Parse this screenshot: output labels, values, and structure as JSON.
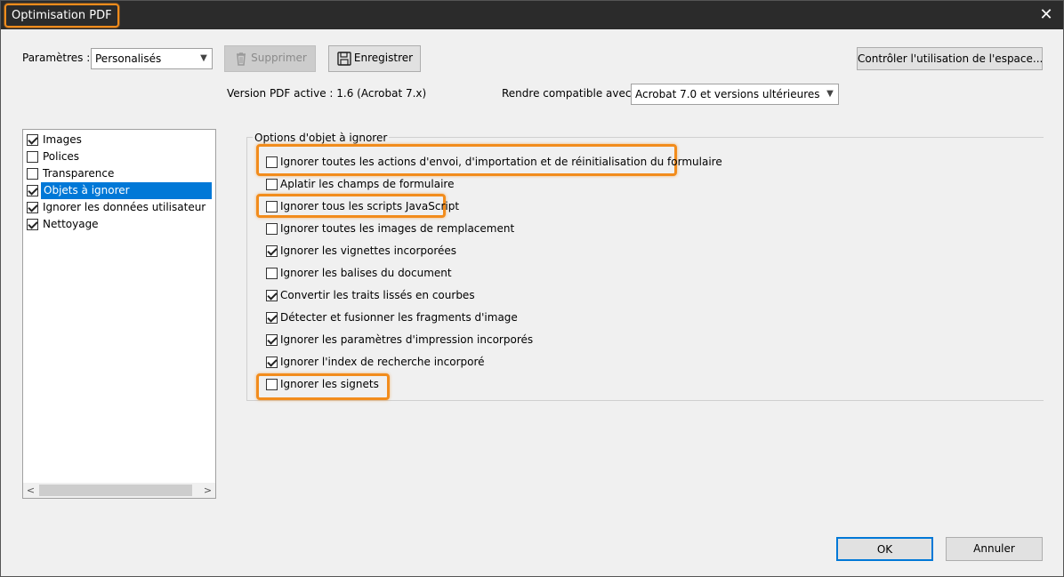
{
  "window": {
    "title": "Optimisation PDF",
    "close_glyph": "✕"
  },
  "toolbar": {
    "settings_label": "Paramètres :",
    "settings_value": "Personalisés",
    "delete_label": "Supprimer",
    "save_label": "Enregistrer",
    "check_space_label": "Contrôler l'utilisation de l'espace..."
  },
  "info": {
    "version_text": "Version PDF active : 1.6 (Acrobat 7.x)",
    "compat_label": "Rendre compatible avec :",
    "compat_value": "Acrobat 7.0 et versions ultérieures"
  },
  "sidebar": {
    "items": [
      {
        "label": "Images",
        "checked": true,
        "selected": false
      },
      {
        "label": "Polices",
        "checked": false,
        "selected": false
      },
      {
        "label": "Transparence",
        "checked": false,
        "selected": false
      },
      {
        "label": "Objets à ignorer",
        "checked": true,
        "selected": true
      },
      {
        "label": "Ignorer les données utilisateur",
        "checked": true,
        "selected": false
      },
      {
        "label": "Nettoyage",
        "checked": true,
        "selected": false
      }
    ]
  },
  "options": {
    "group_title": "Options d'objet à ignorer",
    "items": [
      {
        "label": "Ignorer toutes les actions d'envoi, d'importation et de réinitialisation du formulaire",
        "checked": false,
        "highlighted": true
      },
      {
        "label": "Aplatir les champs de formulaire",
        "checked": false,
        "highlighted": false
      },
      {
        "label": "Ignorer tous les scripts JavaScript",
        "checked": false,
        "highlighted": true
      },
      {
        "label": "Ignorer toutes les images de remplacement",
        "checked": false,
        "highlighted": false
      },
      {
        "label": "Ignorer les vignettes incorporées",
        "checked": true,
        "highlighted": false
      },
      {
        "label": "Ignorer les balises du document",
        "checked": false,
        "highlighted": false
      },
      {
        "label": "Convertir les traits lissés en courbes",
        "checked": true,
        "highlighted": false
      },
      {
        "label": "Détecter et fusionner les fragments d'image",
        "checked": true,
        "highlighted": false
      },
      {
        "label": "Ignorer les paramètres d'impression incorporés",
        "checked": true,
        "highlighted": false
      },
      {
        "label": "Ignorer l'index de recherche incorporé",
        "checked": true,
        "highlighted": false
      },
      {
        "label": "Ignorer les signets",
        "checked": false,
        "highlighted": true
      }
    ]
  },
  "footer": {
    "ok_label": "OK",
    "cancel_label": "Annuler"
  },
  "colors": {
    "highlight": "#f28c1c",
    "selection": "#0078d7"
  }
}
